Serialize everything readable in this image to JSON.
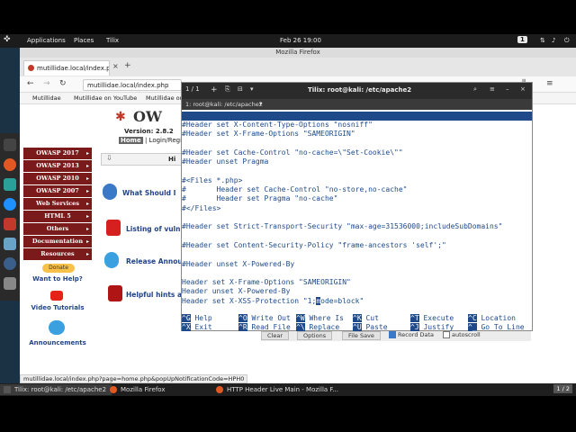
{
  "panel": {
    "applications": "Applications",
    "places": "Places",
    "tilix": "Tilix",
    "datetime": "Feb 26  19:00",
    "workspace": "1"
  },
  "firefox": {
    "window_title": "Mozilla Firefox",
    "tab_title": "mutillidae.local/index.p",
    "url": "mutillidae.local/index.php",
    "bookmarks": [
      "Mutillidae",
      "Mutillidae on YouTube",
      "Mutillidae on"
    ]
  },
  "mutillidae": {
    "logo": "OW",
    "version": "Version: 2.8.2",
    "menu_home": "Home",
    "menu_rest": "| Login/Regi",
    "sidebar": [
      "OWASP 2017",
      "OWASP 2013",
      "OWASP 2010",
      "OWASP 2007",
      "Web Services",
      "HTML 5",
      "Others",
      "Documentation",
      "Resources"
    ],
    "donate": "Donate",
    "want_help": "Want to Help?",
    "video_tutorials": "Video Tutorials",
    "announcements": "Announcements",
    "hint_box": "Hi",
    "main_links": [
      "What Should I",
      "Listing of vuln",
      "Release Annou",
      "Helpful hints a"
    ]
  },
  "terminal": {
    "tab_counter": "1 / 1",
    "title": "Tilix: root@kali: /etc/apache2",
    "session": "1: root@kali: /etc/apache2",
    "nano_header_left": "  GNU nano 5.4",
    "nano_header_file": "conf/headers.conf *",
    "lines": [
      "#Header set X-Content-Type-Options \"nosniff\"",
      "#Header set X-Frame-Options \"SAMEORIGIN\"",
      "",
      "#Header set Cache-Control \"no-cache=\\\"Set-Cookie\\\"\"",
      "#Header unset Pragma",
      "",
      "#<Files *.php>",
      "#       Header set Cache-Control \"no-store,no-cache\"",
      "#       Header set Pragma \"no-cache\"",
      "#</Files>",
      "",
      "#Header set Strict-Transport-Security \"max-age=31536000;includeSubDomains\"",
      "",
      "#Header set Content-Security-Policy \"frame-ancestors 'self';\"",
      "",
      "#Header unset X-Powered-By",
      "",
      "Header set X-Frame-Options \"SAMEORIGIN\"",
      "Header unset X-Powered-By"
    ],
    "cursor_line_before": "Header set X-XSS-Protection \"1;",
    "cursor_char": "m",
    "cursor_line_after": "ode=block\"",
    "shortcuts_row1": [
      {
        "key": "^G",
        "label": "Help"
      },
      {
        "key": "^O",
        "label": "Write Out"
      },
      {
        "key": "^W",
        "label": "Where Is"
      },
      {
        "key": "^K",
        "label": "Cut"
      },
      {
        "key": "^T",
        "label": "Execute"
      },
      {
        "key": "^C",
        "label": "Location"
      }
    ],
    "shortcuts_row2": [
      {
        "key": "^X",
        "label": "Exit"
      },
      {
        "key": "^R",
        "label": "Read File"
      },
      {
        "key": "^\\",
        "label": "Replace"
      },
      {
        "key": "^U",
        "label": "Paste"
      },
      {
        "key": "^J",
        "label": "Justify"
      },
      {
        "key": "^_",
        "label": "Go To Line"
      }
    ]
  },
  "header_live": {
    "clear": "Clear",
    "options": "Options",
    "file_save": "File Save",
    "record_data": "Record Data",
    "autoscroll": "autoscroll"
  },
  "status_url": "mutillidae.local/index.php?page=home.php&popUpNotificationCode=HPH0",
  "taskbar": {
    "tasks": [
      "Tilix: root@kali: /etc/apache2",
      "Mozilla Firefox",
      "HTTP Header Live Main - Mozilla F..."
    ],
    "pager": "1 / 2"
  }
}
